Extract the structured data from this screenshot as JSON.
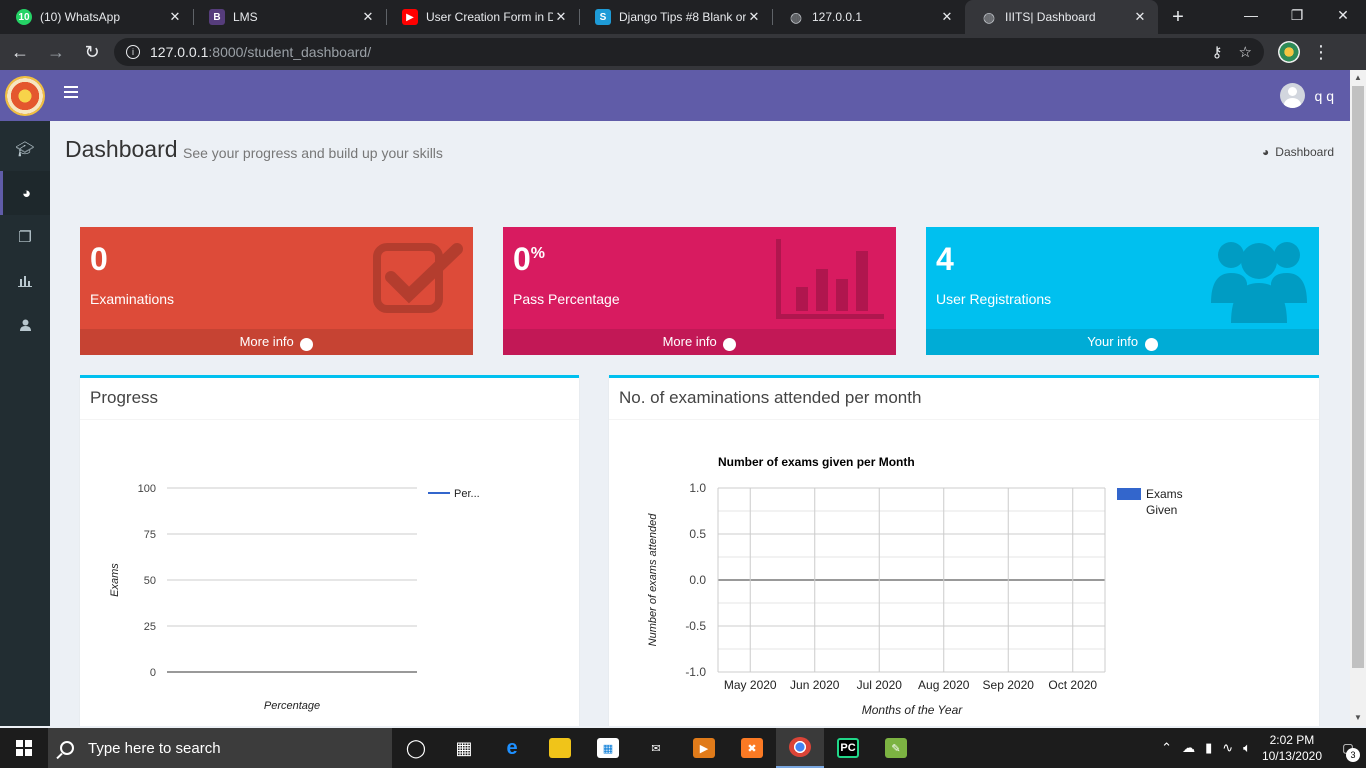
{
  "browser": {
    "tabs": [
      {
        "title": "(10) WhatsApp",
        "favicon": "whatsapp-icon",
        "fav_text": "10",
        "color": "#25d366"
      },
      {
        "title": "LMS",
        "favicon": "bootstrap-icon",
        "fav_text": "B",
        "color": "#563d7c"
      },
      {
        "title": "User Creation Form in D",
        "favicon": "youtube-icon",
        "fav_text": "▶",
        "color": "#ff0000"
      },
      {
        "title": "Django Tips #8 Blank or",
        "favicon": "s-icon",
        "fav_text": "S",
        "color": "#1e9bd7"
      },
      {
        "title": "127.0.0.1",
        "favicon": "globe-icon",
        "fav_text": "◍",
        "color": "#5f6368"
      },
      {
        "title": "IIITS| Dashboard",
        "favicon": "globe-icon",
        "fav_text": "◍",
        "color": "#5f6368"
      }
    ],
    "url_host": "127.0.0.1",
    "url_path": ":8000/student_dashboard/"
  },
  "header": {
    "username": "q q"
  },
  "page": {
    "title": "Dashboard",
    "subtitle": "See your progress and build up your skills",
    "breadcrumb": "Dashboard"
  },
  "stats": [
    {
      "value": "0",
      "suffix": "",
      "label": "Examinations",
      "link": "More info",
      "icon": "checkbox-icon"
    },
    {
      "value": "0",
      "suffix": "%",
      "label": "Pass Percentage",
      "link": "More info",
      "icon": "bar-chart-icon"
    },
    {
      "value": "4",
      "suffix": "",
      "label": "User Registrations",
      "link": "Your info",
      "icon": "users-icon"
    }
  ],
  "panels": {
    "progress_title": "Progress",
    "exams_title": "No. of examinations attended per month"
  },
  "chart_data": [
    {
      "type": "line",
      "title": "",
      "xlabel": "Percentage",
      "ylabel": "Exams",
      "yticks": [
        "100",
        "75",
        "50",
        "25",
        "0"
      ],
      "ylim": [
        0,
        100
      ],
      "categories": [],
      "series": [
        {
          "name": "Per...",
          "values": [],
          "color": "#3366cc"
        }
      ],
      "legend": "right",
      "grid": true
    },
    {
      "type": "bar",
      "title": "Number of exams given per Month",
      "xlabel": "Months of the Year",
      "ylabel": "Number of exams attended",
      "categories": [
        "May 2020",
        "Jun 2020",
        "Jul 2020",
        "Aug 2020",
        "Sep 2020",
        "Oct 2020"
      ],
      "yticks": [
        "1.0",
        "0.5",
        "0.0",
        "-0.5",
        "-1.0"
      ],
      "ylim": [
        -1,
        1
      ],
      "series": [
        {
          "name": "Exams Given",
          "name_lines": [
            "Exams",
            "Given"
          ],
          "values": [
            0,
            0,
            0,
            0,
            0,
            0
          ],
          "color": "#3366cc"
        }
      ],
      "legend": "right",
      "grid": true
    }
  ],
  "taskbar": {
    "search_placeholder": "Type here to search",
    "time": "2:02 PM",
    "date": "10/13/2020",
    "notifications": "3"
  }
}
